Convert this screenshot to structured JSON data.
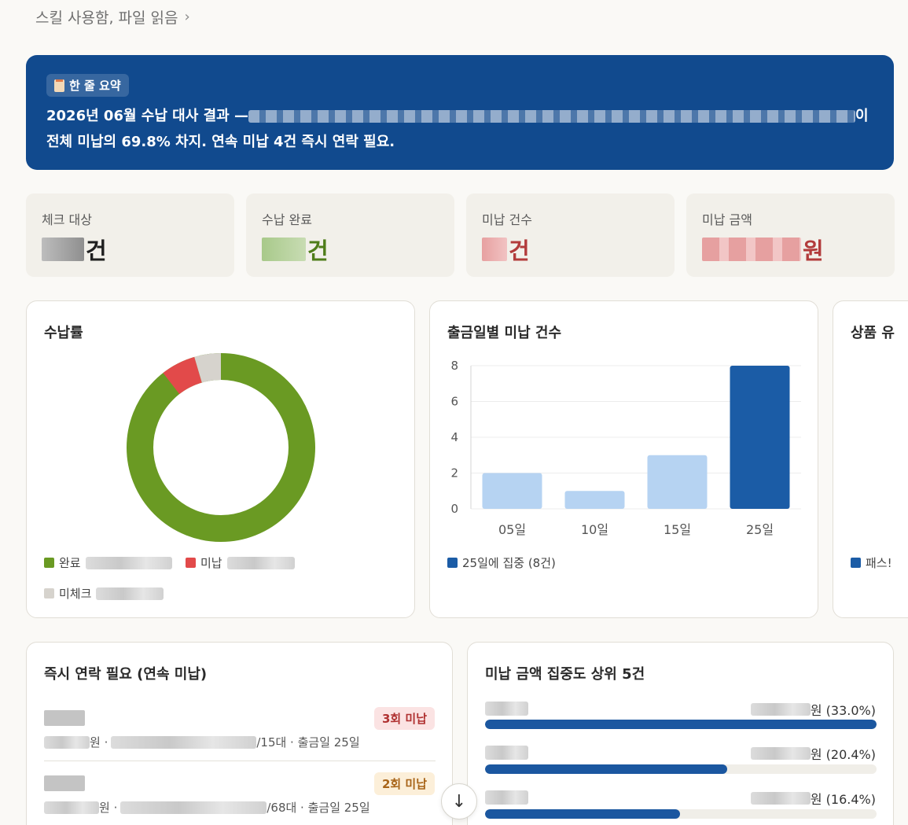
{
  "breadcrumb": {
    "text": "스킬 사용함, 파일 읽음",
    "chevron": "›"
  },
  "banner": {
    "tag": "한 줄 요약",
    "line1_prefix": "2026년 06월 수납 대사 결과 —",
    "line1_suffix": "이",
    "line2": "전체 미납의 69.8% 차지. 연속 미납 4건 즉시 연락 필요."
  },
  "stats": [
    {
      "label": "체크 대상",
      "unit": "건",
      "color": "#1f1f1f"
    },
    {
      "label": "수납 완료",
      "unit": "건",
      "color": "#4f7d1a"
    },
    {
      "label": "미납 건수",
      "unit": "건",
      "color": "#b23b3b"
    },
    {
      "label": "미납 금액",
      "unit": "원",
      "color": "#b23b3b"
    }
  ],
  "donut": {
    "title": "수납률",
    "legend": {
      "complete": "완료",
      "unpaid": "미납",
      "unchecked": "미체크"
    },
    "colors": {
      "complete": "#6a9a23",
      "unpaid": "#e24a4a",
      "unchecked": "#d6d3cd"
    }
  },
  "chart_data": {
    "type": "bar",
    "title": "출금일별 미납 건수",
    "categories": [
      "05일",
      "10일",
      "15일",
      "25일"
    ],
    "values": [
      2,
      1,
      3,
      8
    ],
    "ylim": [
      0,
      8
    ],
    "yticks": [
      "0",
      "2",
      "4",
      "6",
      "8"
    ],
    "colors": [
      "#b6d3f2",
      "#b6d3f2",
      "#b6d3f2",
      "#1b5ca6"
    ],
    "legend": "25일에 집중 (8건)",
    "grid": true
  },
  "product_panel": {
    "title": "상품 유",
    "legend": "패스!"
  },
  "urgent": {
    "title": "즉시 연락 필요 (연속 미납)",
    "rows": [
      {
        "won": "원 ·",
        "tail": "/15대 · 출금일 25일",
        "badge": "3회 미납"
      },
      {
        "won": "원 ·",
        "tail": "/68대 · 출금일 25일",
        "badge": "2회 미납"
      }
    ]
  },
  "concentration": {
    "title": "미납 금액 집중도 상위 5건",
    "rows": [
      {
        "label": "원 (33.0%)",
        "share": 1.0
      },
      {
        "label": "원 (20.4%)",
        "share": 0.618
      },
      {
        "label": "원 (16.4%)",
        "share": 0.497
      }
    ]
  },
  "scroll_button": {
    "icon": "↓"
  }
}
